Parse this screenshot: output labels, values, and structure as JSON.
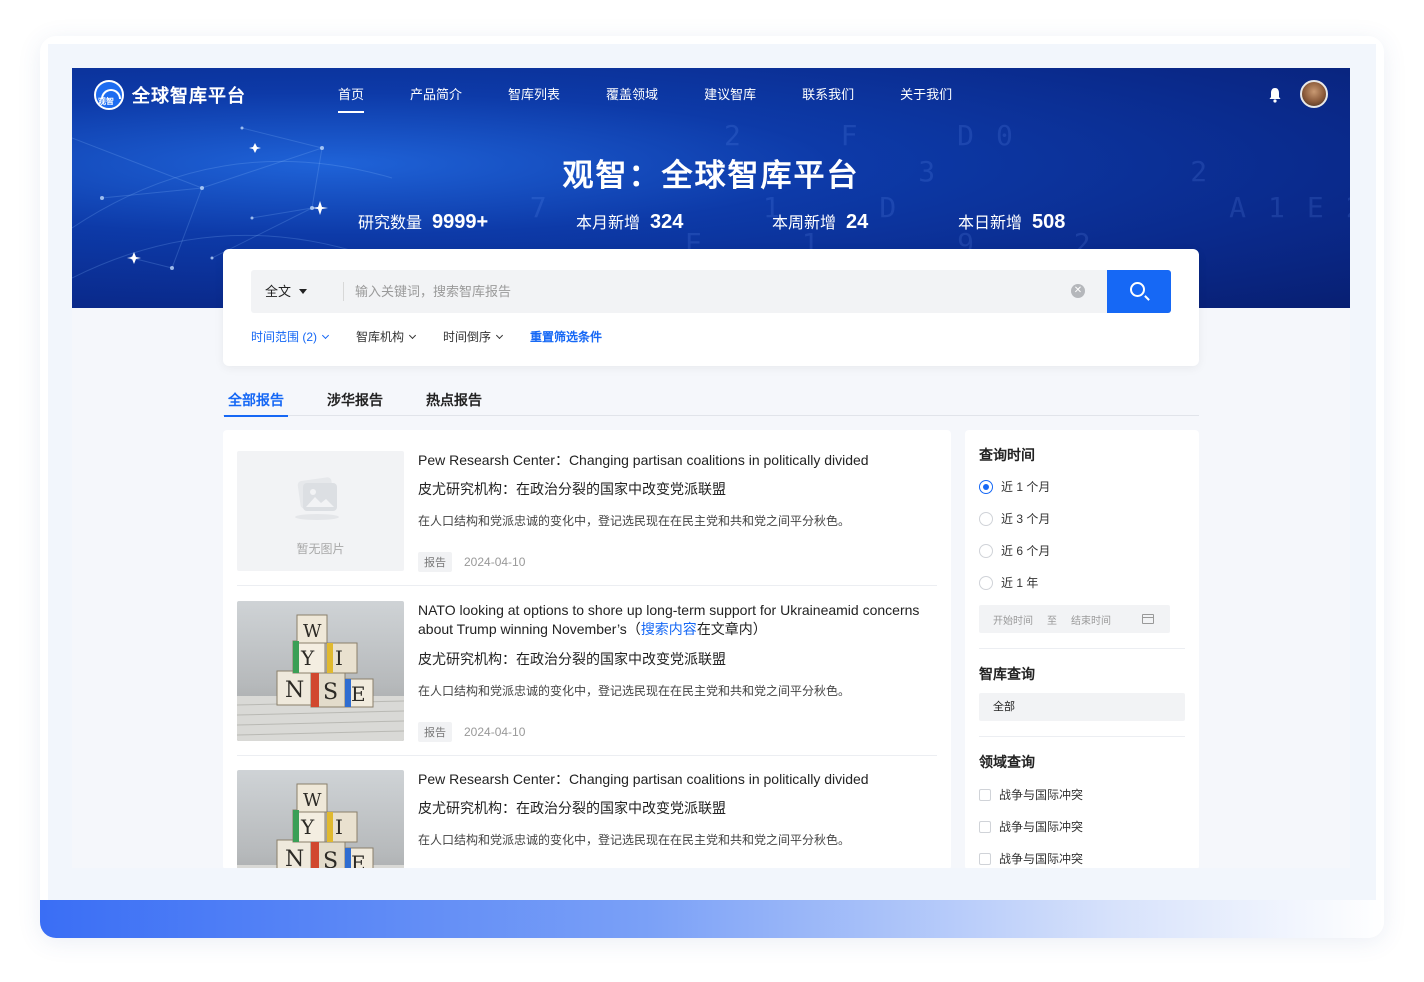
{
  "brand": {
    "name": "全球智库平台"
  },
  "nav": {
    "items": [
      {
        "label": "首页",
        "active": true
      },
      {
        "label": "产品简介"
      },
      {
        "label": "智库列表"
      },
      {
        "label": "覆盖领域"
      },
      {
        "label": "建议智库"
      },
      {
        "label": "联系我们"
      },
      {
        "label": "关于我们"
      }
    ]
  },
  "hero": {
    "title": "观智：全球智库平台",
    "stats": [
      {
        "label": "研究数量",
        "value": "9999+"
      },
      {
        "label": "本月新增",
        "value": "324"
      },
      {
        "label": "本周新增",
        "value": "24"
      },
      {
        "label": "本日新增",
        "value": "508"
      }
    ]
  },
  "search": {
    "scope": "全文",
    "placeholder": "输入关键词，搜索智库报告",
    "clear_icon": "close-circle-icon",
    "button_icon": "search-icon",
    "filters": [
      {
        "label": "时间范围 (2)",
        "highlighted": true
      },
      {
        "label": "智库机构"
      },
      {
        "label": "时间倒序"
      }
    ],
    "reset": "重置筛选条件"
  },
  "tabs": [
    {
      "label": "全部报告",
      "active": true
    },
    {
      "label": "涉华报告"
    },
    {
      "label": "热点报告"
    }
  ],
  "reports": [
    {
      "image": "none",
      "no_image_text": "暂无图片",
      "title": "Pew Researsh Center：Changing partisan coalitions in politically divided",
      "subtitle": "皮尤研究机构：在政治分裂的国家中改变党派联盟",
      "desc": "在人口结构和党派忠诚的变化中，登记选民现在在民主党和共和党之间平分秋色。",
      "tag": "报告",
      "date": "2024-04-10"
    },
    {
      "image": "news-cubes-photo",
      "title_main": "NATO looking at options to shore up long-term support for Ukraineamid concerns about Trump winning November’s（",
      "title_highlight": "搜索内容",
      "title_tail": "在文章内）",
      "subtitle": "皮尤研究机构：在政治分裂的国家中改变党派联盟",
      "desc": "在人口结构和党派忠诚的变化中，登记选民现在在民主党和共和党之间平分秋色。",
      "tag": "报告",
      "date": "2024-04-10"
    },
    {
      "image": "news-cubes-photo",
      "title": "Pew Researsh Center：Changing partisan coalitions in politically divided",
      "subtitle": "皮尤研究机构：在政治分裂的国家中改变党派联盟",
      "desc": "在人口结构和党派忠诚的变化中，登记选民现在在民主党和共和党之间平分秋色。"
    }
  ],
  "sidebar": {
    "time": {
      "heading": "查询时间",
      "options": [
        {
          "label": "近 1 个月",
          "selected": true
        },
        {
          "label": "近 3 个月"
        },
        {
          "label": "近 6 个月"
        },
        {
          "label": "近 1 年"
        }
      ],
      "start_placeholder": "开始时间",
      "to": "至",
      "end_placeholder": "结束时间"
    },
    "think_tank": {
      "heading": "智库查询",
      "value": "全部"
    },
    "domain": {
      "heading": "领域查询",
      "options": [
        {
          "label": "战争与国际冲突"
        },
        {
          "label": "战争与国际冲突"
        },
        {
          "label": "战争与国际冲突"
        }
      ]
    }
  },
  "colors": {
    "primary": "#1668f5",
    "hero_dark": "#0a2a8c"
  }
}
